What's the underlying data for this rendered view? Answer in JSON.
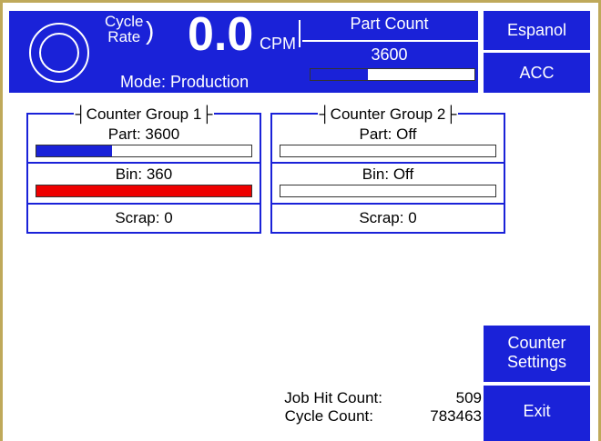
{
  "header": {
    "cycle_rate_label_line1": "Cycle",
    "cycle_rate_label_line2": "Rate",
    "cycle_rate_value": "0.0",
    "cycle_rate_unit": "CPM",
    "mode_text": "Mode: Production",
    "part_count_title": "Part Count",
    "part_count_value": "3600",
    "part_count_progress": 0.35
  },
  "side_buttons": {
    "espanol": "Espanol",
    "acc": "ACC",
    "counter_settings_line1": "Counter",
    "counter_settings_line2": "Settings",
    "exit": "Exit"
  },
  "groups": [
    {
      "title": "Counter Group 1",
      "part_label": "Part: 3600",
      "part_progress": 0.35,
      "bin_label": "Bin: 360",
      "bin_progress": 1.0,
      "scrap_label": "Scrap: 0"
    },
    {
      "title": "Counter Group 2",
      "part_label": "Part: Off",
      "part_progress": 0,
      "bin_label": "Bin: Off",
      "bin_progress": 0,
      "scrap_label": "Scrap: 0"
    }
  ],
  "footer": {
    "job_hit_label": "Job Hit Count:",
    "job_hit_value": "509",
    "cycle_count_label": "Cycle Count:",
    "cycle_count_value": "783463"
  },
  "colors": {
    "primary": "#1a22d8",
    "bin_alarm": "#ee0000",
    "frame": "#bfa95a"
  }
}
